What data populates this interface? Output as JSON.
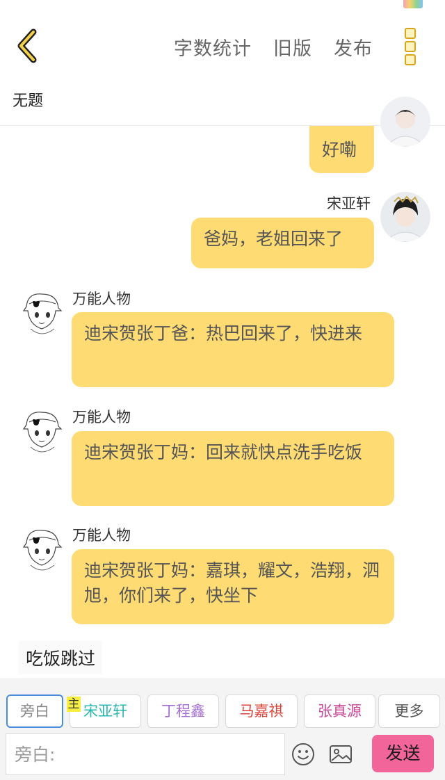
{
  "header": {
    "back_icon": "chevron-left-icon",
    "links": [
      "字数统计",
      "旧版",
      "发布"
    ],
    "more_icon": "vertical-dots-icon",
    "accent_color": "#d8a51b"
  },
  "document": {
    "title": "无题"
  },
  "messages": [
    {
      "side": "right",
      "speaker": "",
      "text": "好嘞"
    },
    {
      "side": "right",
      "speaker": "宋亚轩",
      "text": "爸妈，老姐回来了"
    },
    {
      "side": "left",
      "speaker": "万能人物",
      "text": "迪宋贺张丁爸：热巴回来了，快进来"
    },
    {
      "side": "left",
      "speaker": "万能人物",
      "text": "迪宋贺张丁妈：回来就快点洗手吃饭"
    },
    {
      "side": "left",
      "speaker": "万能人物",
      "text": "迪宋贺张丁妈：嘉琪，耀文，浩翔，泗旭，你们来了，快坐下"
    }
  ],
  "narration": "吃饭跳过",
  "bubble_color": "#fedb73",
  "composer": {
    "main_tag": "主",
    "chips": [
      {
        "label": "旁白",
        "color": "#888888"
      },
      {
        "label": "宋亚轩",
        "color": "#2bb7b0"
      },
      {
        "label": "丁程鑫",
        "color": "#a46fd1"
      },
      {
        "label": "马嘉祺",
        "color": "#d9453a"
      },
      {
        "label": "张真源",
        "color": "#c94a9a"
      },
      {
        "label": "更多",
        "color": "#555555"
      }
    ],
    "input_placeholder": "旁白:",
    "emoji_icon": "smiley-icon",
    "image_icon": "image-icon",
    "send_label": "发送",
    "send_color": "#f2659a"
  }
}
